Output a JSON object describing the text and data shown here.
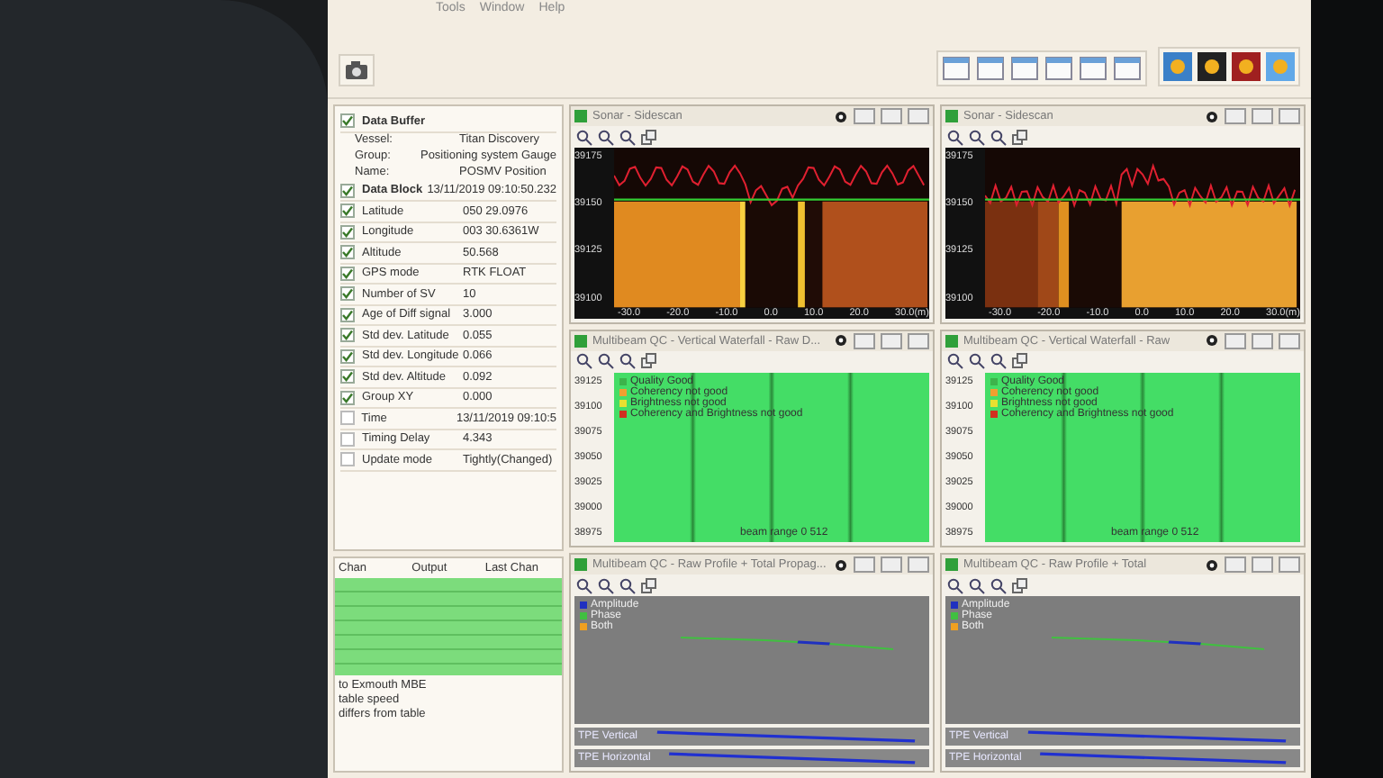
{
  "menu": [
    "Tools",
    "Window",
    "Help"
  ],
  "data_panel": {
    "buffer_title": "Data Buffer",
    "buffer_checked": true,
    "buffer_fields": [
      {
        "label": "Vessel:",
        "value": "Titan Discovery"
      },
      {
        "label": "Group:",
        "value": "Positioning system Gauge"
      },
      {
        "label": "Name:",
        "value": "POSMV Position"
      }
    ],
    "block_title": "Data Block",
    "block_checked": true,
    "block_time": "13/11/2019 09:10:50.232",
    "block_fields": [
      {
        "label": "Latitude",
        "value": "050 29.0976",
        "checked": true
      },
      {
        "label": "Longitude",
        "value": "003 30.6361W",
        "checked": true
      },
      {
        "label": "Altitude",
        "value": "50.568",
        "checked": true
      },
      {
        "label": "GPS mode",
        "value": "RTK FLOAT",
        "checked": true
      },
      {
        "label": "Number of SV",
        "value": "10",
        "checked": true
      },
      {
        "label": "Age of Diff signal",
        "value": "3.000",
        "checked": true
      },
      {
        "label": "Std dev. Latitude",
        "value": "0.055",
        "checked": true
      },
      {
        "label": "Std dev. Longitude",
        "value": "0.066",
        "checked": true
      },
      {
        "label": "Std dev. Altitude",
        "value": "0.092",
        "checked": true
      },
      {
        "label": "Group XY",
        "value": "0.000",
        "checked": true
      },
      {
        "label": "Time",
        "value": "13/11/2019 09:10:5",
        "checked": false
      },
      {
        "label": "Timing Delay",
        "value": "4.343",
        "checked": false
      },
      {
        "label": "Update mode",
        "value": "Tightly(Changed)",
        "checked": false
      }
    ]
  },
  "channel_table": {
    "columns": [
      "Chan",
      "Output",
      "Last Chan"
    ]
  },
  "notes": [
    "to Exmouth MBE",
    "table speed",
    "differs from table"
  ],
  "panes": [
    {
      "kind": "sonar",
      "title": "Sonar - Sidescan",
      "y_labels": [
        "39175",
        "39150",
        "39125",
        "39100"
      ],
      "x_labels": [
        "-30.0",
        "-20.0",
        "-10.0",
        "0.0",
        "10.0",
        "20.0",
        "30.0(m)"
      ]
    },
    {
      "kind": "sonar",
      "title": "Sonar - Sidescan",
      "y_labels": [
        "39175",
        "39150",
        "39125",
        "39100"
      ],
      "x_labels": [
        "-30.0",
        "-20.0",
        "-10.0",
        "0.0",
        "10.0",
        "20.0",
        "30.0(m)"
      ]
    },
    {
      "kind": "waterfall",
      "title": "Multibeam QC - Vertical Waterfall - Raw D...",
      "legend": [
        {
          "label": "Quality Good",
          "color": "#3cb44b"
        },
        {
          "label": "Coherency not good",
          "color": "#f0a030"
        },
        {
          "label": "Brightness not good",
          "color": "#e8e030"
        },
        {
          "label": "Coherency and Brightness not good",
          "color": "#d03020"
        }
      ],
      "y_labels": [
        "39125",
        "39100",
        "39075",
        "39050",
        "39025",
        "39000",
        "38975"
      ],
      "beam_range": "beam range 0 512"
    },
    {
      "kind": "waterfall",
      "title": "Multibeam QC - Vertical Waterfall - Raw",
      "legend": [
        {
          "label": "Quality Good",
          "color": "#3cb44b"
        },
        {
          "label": "Coherency not good",
          "color": "#f0a030"
        },
        {
          "label": "Brightness not good",
          "color": "#e8e030"
        },
        {
          "label": "Coherency and Brightness not good",
          "color": "#d03020"
        }
      ],
      "y_labels": [
        "39125",
        "39100",
        "39075",
        "39050",
        "39025",
        "39000",
        "38975"
      ],
      "beam_range": "beam range 0 512"
    },
    {
      "kind": "profile",
      "title": "Multibeam QC - Raw Profile + Total Propag...",
      "legend": [
        {
          "label": "Amplitude",
          "color": "#2030c0"
        },
        {
          "label": "Phase",
          "color": "#40c040"
        },
        {
          "label": "Both",
          "color": "#f0a020"
        }
      ],
      "tracks": [
        "TPE Vertical",
        "TPE Horizontal"
      ]
    },
    {
      "kind": "profile",
      "title": "Multibeam QC - Raw Profile + Total",
      "legend": [
        {
          "label": "Amplitude",
          "color": "#2030c0"
        },
        {
          "label": "Phase",
          "color": "#40c040"
        },
        {
          "label": "Both",
          "color": "#f0a020"
        }
      ],
      "tracks": [
        "TPE Vertical",
        "TPE Horizontal"
      ]
    }
  ]
}
